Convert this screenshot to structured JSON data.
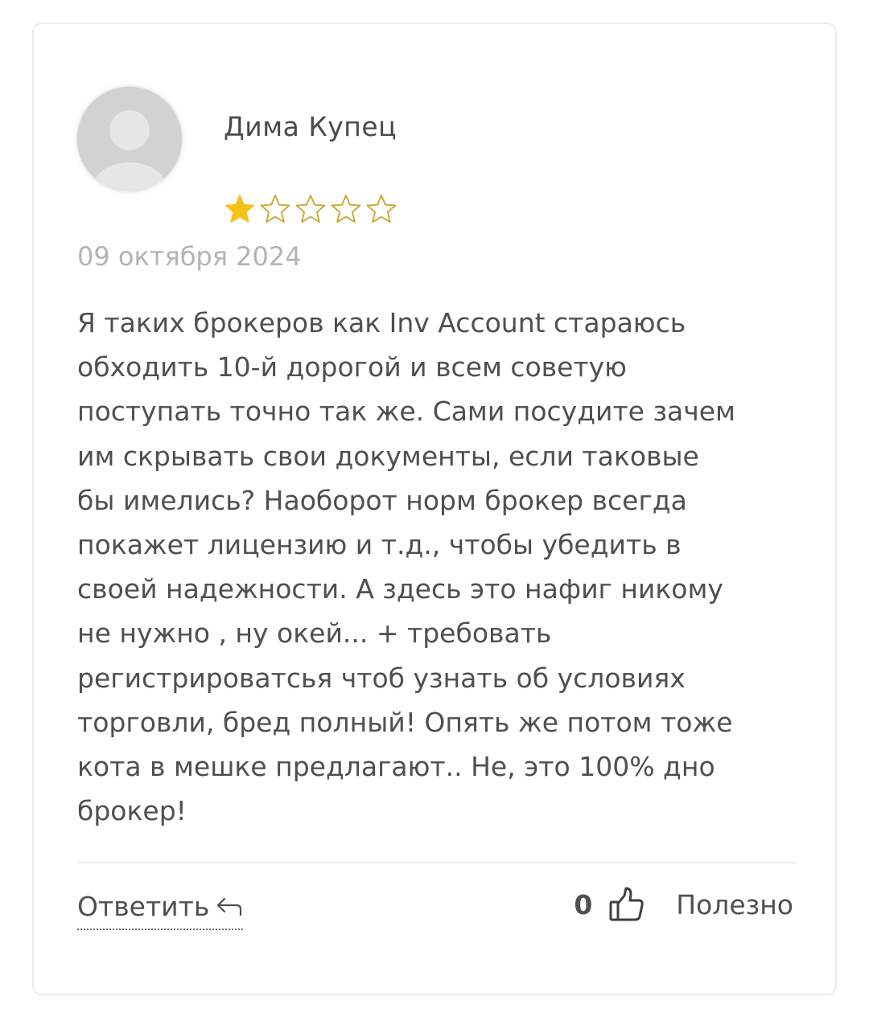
{
  "review": {
    "author_name": "Дима Купец",
    "rating": 1,
    "max_rating": 5,
    "date": "09 октября 2024",
    "text": "Я таких брокеров как Inv Account стараюсь\nобходить 10-й дорогой и всем советую\nпоступать точно так же. Сами посудите зачем\nим скрывать свои документы, если таковые\nбы имелись? Наоборот норм брокер всегда\nпокажет лицензию и т.д., чтобы убедить в\nсвоей надежности. А здесь это нафиг никому\nне нужно , ну окей... + требовать\nрегистрироватсья чтоб узнать об условиях\nторговли, бред полный! Опять же потом тоже\nкота в мешке предлагают.. Не, это 100% дно\nброкер!"
  },
  "actions": {
    "reply_label": "Ответить",
    "useful_count": "0",
    "useful_label": "Полезно"
  },
  "icons": {
    "avatar": "default-user-avatar",
    "star_filled": "star-filled-icon",
    "star_empty": "star-outline-icon",
    "reply": "reply-arrow-icon",
    "thumb": "thumbs-up-icon"
  },
  "colors": {
    "star": "#f2c318",
    "star_outline": "#c9a526",
    "text": "#4f4f4f",
    "muted": "#b3b3b3"
  }
}
